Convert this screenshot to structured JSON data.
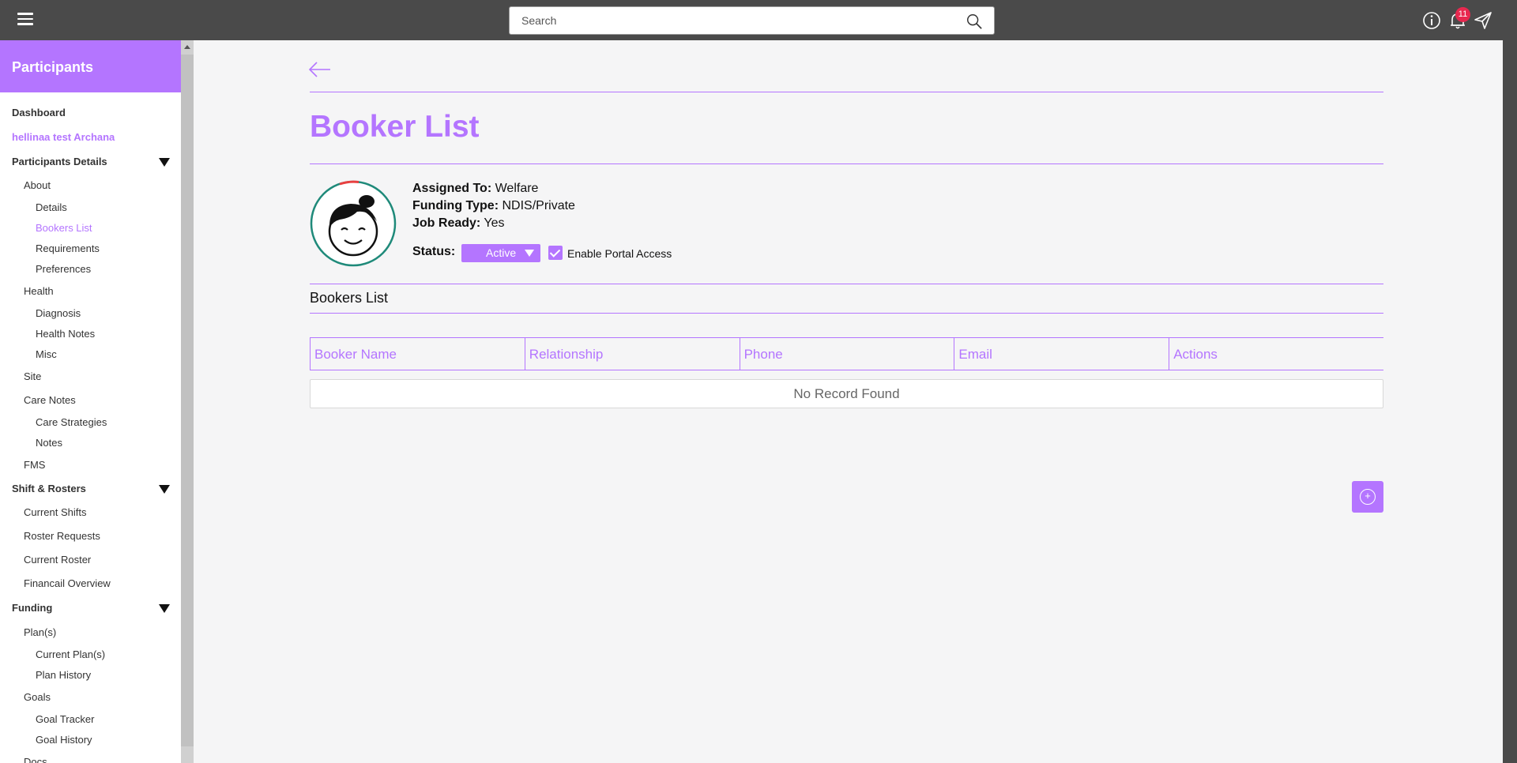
{
  "header": {
    "search_placeholder": "Search",
    "notification_count": "11",
    "icons": [
      "menu-icon",
      "search-icon",
      "info-icon",
      "bell-icon",
      "send-icon"
    ]
  },
  "sidebar": {
    "title": "Participants",
    "items": [
      {
        "label": "Dashboard"
      },
      {
        "label": "hellinaa test Archana"
      },
      {
        "label": "Participants Details"
      },
      {
        "label": "About"
      },
      {
        "label": "Details"
      },
      {
        "label": "Bookers List"
      },
      {
        "label": "Requirements"
      },
      {
        "label": "Preferences"
      },
      {
        "label": "Health"
      },
      {
        "label": "Diagnosis"
      },
      {
        "label": "Health Notes"
      },
      {
        "label": "Misc"
      },
      {
        "label": "Site"
      },
      {
        "label": "Care Notes"
      },
      {
        "label": "Care Strategies"
      },
      {
        "label": "Notes"
      },
      {
        "label": "FMS"
      },
      {
        "label": "Shift & Rosters"
      },
      {
        "label": "Current Shifts"
      },
      {
        "label": "Roster Requests"
      },
      {
        "label": "Current Roster"
      },
      {
        "label": "Financail Overview"
      },
      {
        "label": "Funding"
      },
      {
        "label": "Plan(s)"
      },
      {
        "label": "Current Plan(s)"
      },
      {
        "label": "Plan History"
      },
      {
        "label": "Goals"
      },
      {
        "label": "Goal Tracker"
      },
      {
        "label": "Goal History"
      },
      {
        "label": "Docs"
      }
    ]
  },
  "main": {
    "title": "Booker List",
    "profile": {
      "assigned_to_label": "Assigned To:",
      "assigned_to": "Welfare",
      "funding_type_label": "Funding Type:",
      "funding_type": "NDIS/Private",
      "job_ready_label": "Job Ready:",
      "job_ready": "Yes",
      "status_label": "Status:",
      "status": "Active",
      "portal_access_label": "Enable Portal Access",
      "portal_access_checked": true
    },
    "section_title": "Bookers List",
    "table": {
      "columns": [
        "Booker Name",
        "Relationship",
        "Phone",
        "Email",
        "Actions"
      ],
      "empty_text": "No Record Found"
    }
  },
  "colors": {
    "accent": "#b475ff",
    "topbar": "#4a4a4a",
    "badge": "#e8284f"
  }
}
